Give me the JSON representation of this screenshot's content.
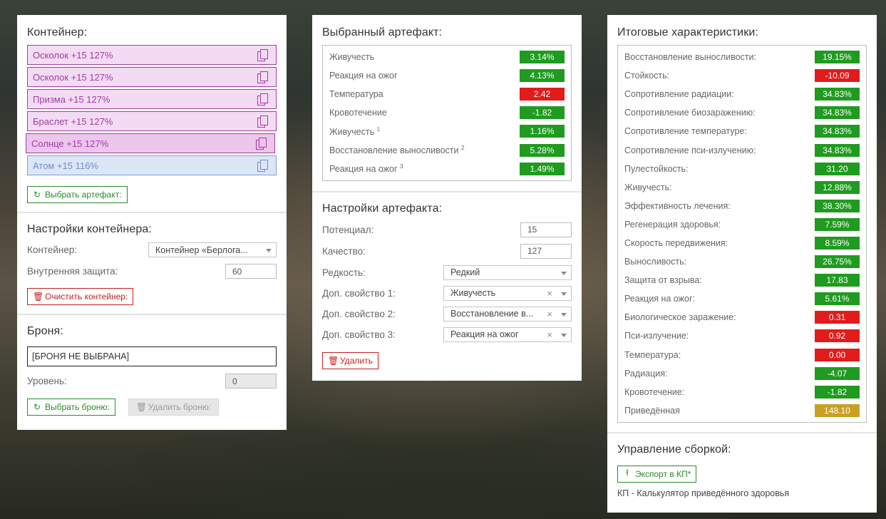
{
  "left": {
    "container_title": "Контейнер:",
    "items": [
      {
        "label": "Осколок +15 127%",
        "kind": "pink"
      },
      {
        "label": "Осколок +15 127%",
        "kind": "pink"
      },
      {
        "label": "Призма +15 127%",
        "kind": "pink"
      },
      {
        "label": "Браслет +15 127%",
        "kind": "pink"
      },
      {
        "label": "Солнце +15 127%",
        "kind": "sun"
      },
      {
        "label": "Атом +15 116%",
        "kind": "atom"
      }
    ],
    "choose_artifact": "Выбрать артефакт:",
    "settings_title": "Настройки контейнера:",
    "container_label": "Контейнер:",
    "container_value": "Контейнер «Берлога...",
    "protection_label": "Внутренняя защита:",
    "protection_value": "60",
    "clear_container": "Очистить контейнер:",
    "armor_title": "Броня:",
    "armor_value": "[БРОНЯ НЕ ВЫБРАНА]",
    "level_label": "Уровень:",
    "level_value": "0",
    "choose_armor": "Выбрать броню:",
    "delete_armor": "Удалить броню:"
  },
  "middle": {
    "selected_title": "Выбранный артефакт:",
    "stats": [
      {
        "label": "Живучесть",
        "sup": "",
        "value": "3.14%",
        "color": "g"
      },
      {
        "label": "Реакция на ожог",
        "sup": "",
        "value": "4.13%",
        "color": "g"
      },
      {
        "label": "Температура",
        "sup": "",
        "value": "2.42",
        "color": "r"
      },
      {
        "label": "Кровотечение",
        "sup": "",
        "value": "-1.82",
        "color": "g"
      },
      {
        "label": "Живучесть",
        "sup": "1",
        "value": "1.16%",
        "color": "g"
      },
      {
        "label": "Восстановление выносливости",
        "sup": "2",
        "value": "5.28%",
        "color": "g"
      },
      {
        "label": "Реакция на ожог",
        "sup": "3",
        "value": "1.49%",
        "color": "g"
      }
    ],
    "settings_title": "Настройки артефакта:",
    "potential_label": "Потенциал:",
    "potential_value": "15",
    "quality_label": "Качество:",
    "quality_value": "127",
    "rarity_label": "Редкость:",
    "rarity_value": "Редкий",
    "prop1_label": "Доп. свойство 1:",
    "prop1_value": "Живучесть",
    "prop2_label": "Доп. свойство 2:",
    "prop2_value": "Восстановление в...",
    "prop3_label": "Доп. свойство 3:",
    "prop3_value": "Реакция на ожог",
    "clear_symbol": "×",
    "delete": "Удалить"
  },
  "right": {
    "totals_title": "Итоговые характеристики:",
    "stats": [
      {
        "label": "Восстановление выносливости:",
        "value": "19.15%",
        "color": "g"
      },
      {
        "label": "Стойкость:",
        "value": "-10.09",
        "color": "r"
      },
      {
        "label": "Сопротивление радиации:",
        "value": "34.83%",
        "color": "g"
      },
      {
        "label": "Сопротивление биозаражению:",
        "value": "34.83%",
        "color": "g"
      },
      {
        "label": "Сопротивление температуре:",
        "value": "34.83%",
        "color": "g"
      },
      {
        "label": "Сопротивление пси-излучению:",
        "value": "34.83%",
        "color": "g"
      },
      {
        "label": "Пулестойкость:",
        "value": "31.20",
        "color": "g"
      },
      {
        "label": "Живучесть:",
        "value": "12.88%",
        "color": "g"
      },
      {
        "label": "Эффективность лечения:",
        "value": "38.30%",
        "color": "g"
      },
      {
        "label": "Регенерация здоровья:",
        "value": "7.59%",
        "color": "g"
      },
      {
        "label": "Скорость передвижения:",
        "value": "8.59%",
        "color": "g"
      },
      {
        "label": "Выносливость:",
        "value": "26.75%",
        "color": "g"
      },
      {
        "label": "Защита от взрыва:",
        "value": "17.83",
        "color": "g"
      },
      {
        "label": "Реакция на ожог:",
        "value": "5.61%",
        "color": "g"
      },
      {
        "label": "Биологическое заражение:",
        "value": "0.31",
        "color": "r"
      },
      {
        "label": "Пси-излучение:",
        "value": "0.92",
        "color": "r"
      },
      {
        "label": "Температура:",
        "value": "0.00",
        "color": "r"
      },
      {
        "label": "Радиация:",
        "value": "-4.07",
        "color": "g"
      },
      {
        "label": "Кровотечение:",
        "value": "-1.82",
        "color": "g"
      },
      {
        "label": "Приведённая",
        "value": "148.10",
        "color": "y"
      }
    ],
    "build_title": "Управление сборкой:",
    "export_button": "Экспорт в КП*",
    "footnote": "КП - Калькулятор приведённого здоровья"
  }
}
